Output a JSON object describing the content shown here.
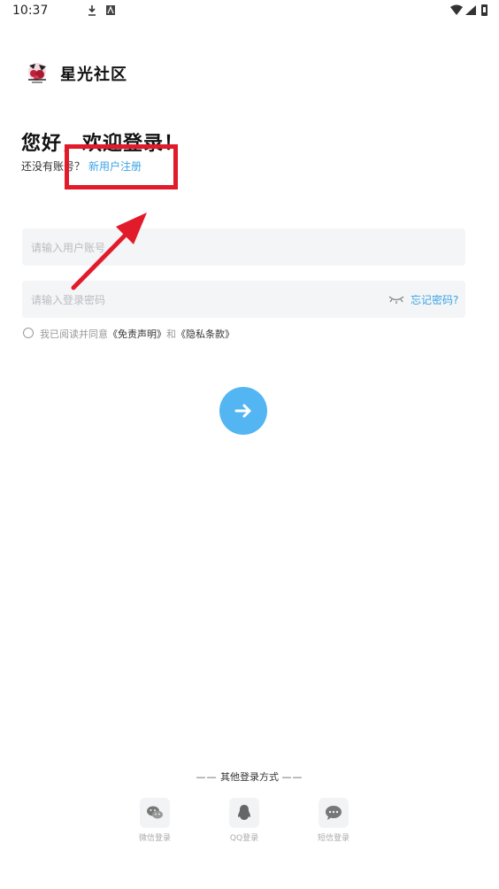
{
  "status_bar": {
    "time": "10:37"
  },
  "header": {
    "app_name": "星光社区"
  },
  "login": {
    "greeting": "您好，欢迎登录！",
    "no_account_text": "还没有账号？",
    "register_link": "新用户注册",
    "username_placeholder": "请输入用户账号",
    "password_placeholder": "请输入登录密码",
    "forgot_password": "忘记密码?",
    "agreement_prefix": "我已阅读并同意",
    "disclaimer_link": "《免责声明》",
    "agreement_and": "和",
    "privacy_link": "《隐私条款》"
  },
  "other_login": {
    "title": "其他登录方式",
    "dash": "——",
    "options": [
      {
        "label": "微信登录",
        "icon": "wechat-icon"
      },
      {
        "label": "QQ登录",
        "icon": "qq-icon"
      },
      {
        "label": "短信登录",
        "icon": "sms-icon"
      }
    ]
  },
  "colors": {
    "accent": "#53b6f2",
    "link": "#3aa4e6",
    "annotation": "#e21b2b",
    "field_bg": "#f4f5f6"
  }
}
